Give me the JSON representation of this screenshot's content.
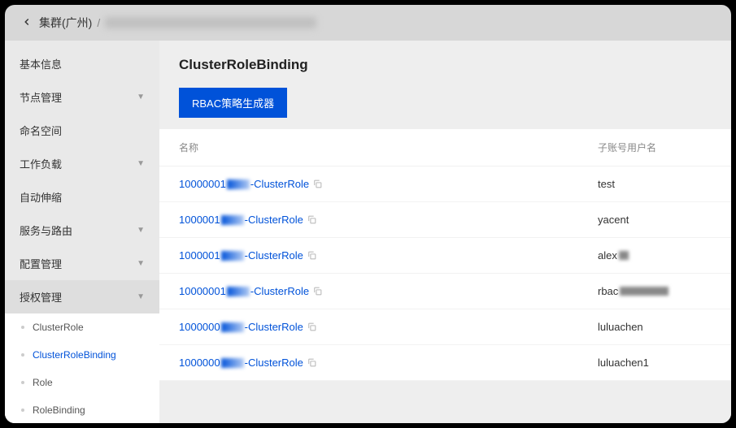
{
  "breadcrumb": {
    "back_label": "集群(广州)",
    "sep": "/"
  },
  "sidebar": {
    "items": [
      {
        "label": "基本信息",
        "expandable": false
      },
      {
        "label": "节点管理",
        "expandable": true
      },
      {
        "label": "命名空间",
        "expandable": false
      },
      {
        "label": "工作负载",
        "expandable": true
      },
      {
        "label": "自动伸缩",
        "expandable": false
      },
      {
        "label": "服务与路由",
        "expandable": true
      },
      {
        "label": "配置管理",
        "expandable": true
      },
      {
        "label": "授权管理",
        "expandable": true,
        "active": true,
        "children": [
          {
            "label": "ClusterRole"
          },
          {
            "label": "ClusterRoleBinding",
            "selected": true
          },
          {
            "label": "Role"
          },
          {
            "label": "RoleBinding"
          }
        ]
      }
    ]
  },
  "page": {
    "title": "ClusterRoleBinding",
    "primary_button": "RBAC策略生成器"
  },
  "table": {
    "headers": {
      "name": "名称",
      "user": "子账号用户名"
    },
    "rows": [
      {
        "prefix": "10000001",
        "suffix": "-ClusterRole",
        "user": "test",
        "user_blur": 0
      },
      {
        "prefix": "1000001",
        "suffix": "-ClusterRole",
        "user": "yacent",
        "user_blur": 0
      },
      {
        "prefix": "1000001",
        "suffix": "-ClusterRole",
        "user": "alex",
        "user_blur": 12
      },
      {
        "prefix": "10000001",
        "suffix": "-ClusterRole",
        "user": "rbac",
        "user_blur": 60
      },
      {
        "prefix": "1000000",
        "suffix": "-ClusterRole",
        "user": "luluachen",
        "user_blur": 0
      },
      {
        "prefix": "1000000",
        "suffix": "-ClusterRole",
        "user": "luluachen1",
        "user_blur": 0
      }
    ]
  }
}
